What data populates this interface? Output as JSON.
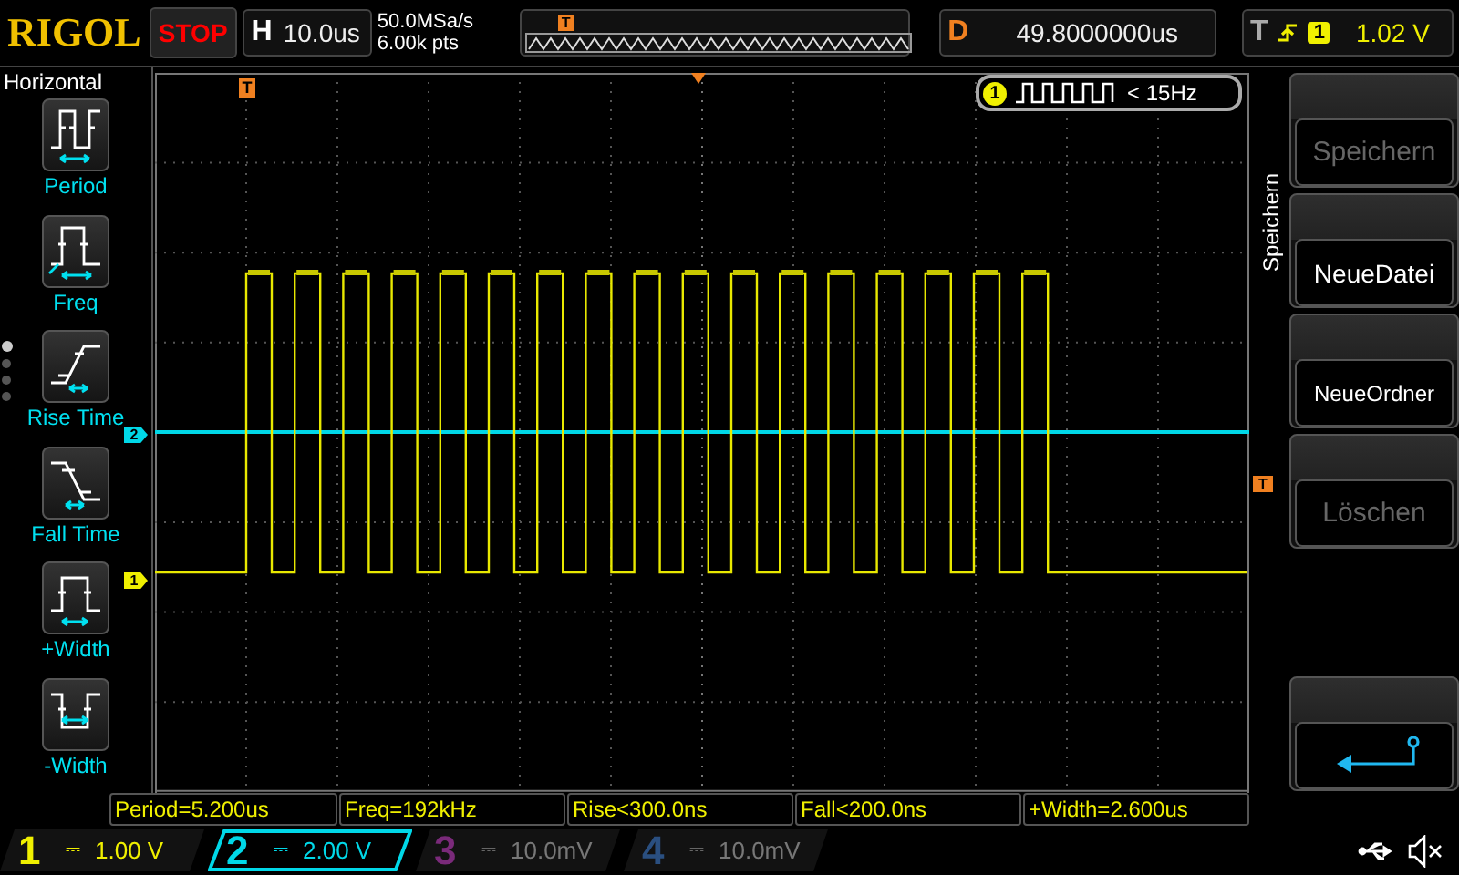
{
  "brand": "RIGOL",
  "run_state": {
    "label": "STOP"
  },
  "timebase": {
    "key": "H",
    "value": "10.0us"
  },
  "sample": {
    "rate": "50.0MSa/s",
    "depth": "6.00k pts"
  },
  "memory": {
    "trigger_mark": "T"
  },
  "delay": {
    "key": "D",
    "value": "49.8000000us"
  },
  "trigger": {
    "key": "T",
    "rising_edge": true,
    "source": "1",
    "level": "1.02 V"
  },
  "sidebar": {
    "title": "Horizontal",
    "items": [
      {
        "kind": "period",
        "label": "Period"
      },
      {
        "kind": "freq",
        "label": "Freq"
      },
      {
        "kind": "rise",
        "label": "Rise Time"
      },
      {
        "kind": "fall",
        "label": "Fall Time"
      },
      {
        "kind": "pwidth",
        "label": "+Width"
      },
      {
        "kind": "nwidth",
        "label": "-Width"
      }
    ],
    "pages": [
      {
        "selected": true
      },
      {
        "selected": false
      },
      {
        "selected": false
      },
      {
        "selected": false
      }
    ]
  },
  "grid": {
    "trigger_mark": "T",
    "level_mark": "T",
    "channel_marks": [
      {
        "label": "2",
        "color": "#00d8e8"
      },
      {
        "label": "1",
        "color": "#f0f000"
      }
    ]
  },
  "counter": {
    "channel": "1",
    "reading": "< 15Hz"
  },
  "menu": {
    "title": "Speichern",
    "buttons": [
      {
        "kind": "text",
        "label": "Speichern",
        "disabled": true
      },
      {
        "kind": "text",
        "label": "NeueDatei",
        "disabled": false
      },
      {
        "kind": "text",
        "label": "NeueOrdner",
        "disabled": false
      },
      {
        "kind": "text",
        "label": "Löschen",
        "disabled": true
      },
      {
        "kind": "back"
      }
    ]
  },
  "measurements": [
    "Period=5.200us",
    "Freq=192kHz",
    "Rise<300.0ns",
    "Fall<200.0ns",
    "+Width=2.600us"
  ],
  "channels": [
    {
      "number": "1",
      "coupling": "⎓",
      "scale": "1.00 V",
      "on": true,
      "selected": false,
      "color": "#f0f000"
    },
    {
      "number": "2",
      "coupling": "⎓",
      "scale": "2.00 V",
      "on": true,
      "selected": true,
      "color": "#00d8e8"
    },
    {
      "number": "3",
      "coupling": "⎓",
      "scale": "10.0mV",
      "on": false,
      "selected": false,
      "color": "#7a2a7a"
    },
    {
      "number": "4",
      "coupling": "⎓",
      "scale": "10.0mV",
      "on": false,
      "selected": false,
      "color": "#2a4f80"
    }
  ]
}
